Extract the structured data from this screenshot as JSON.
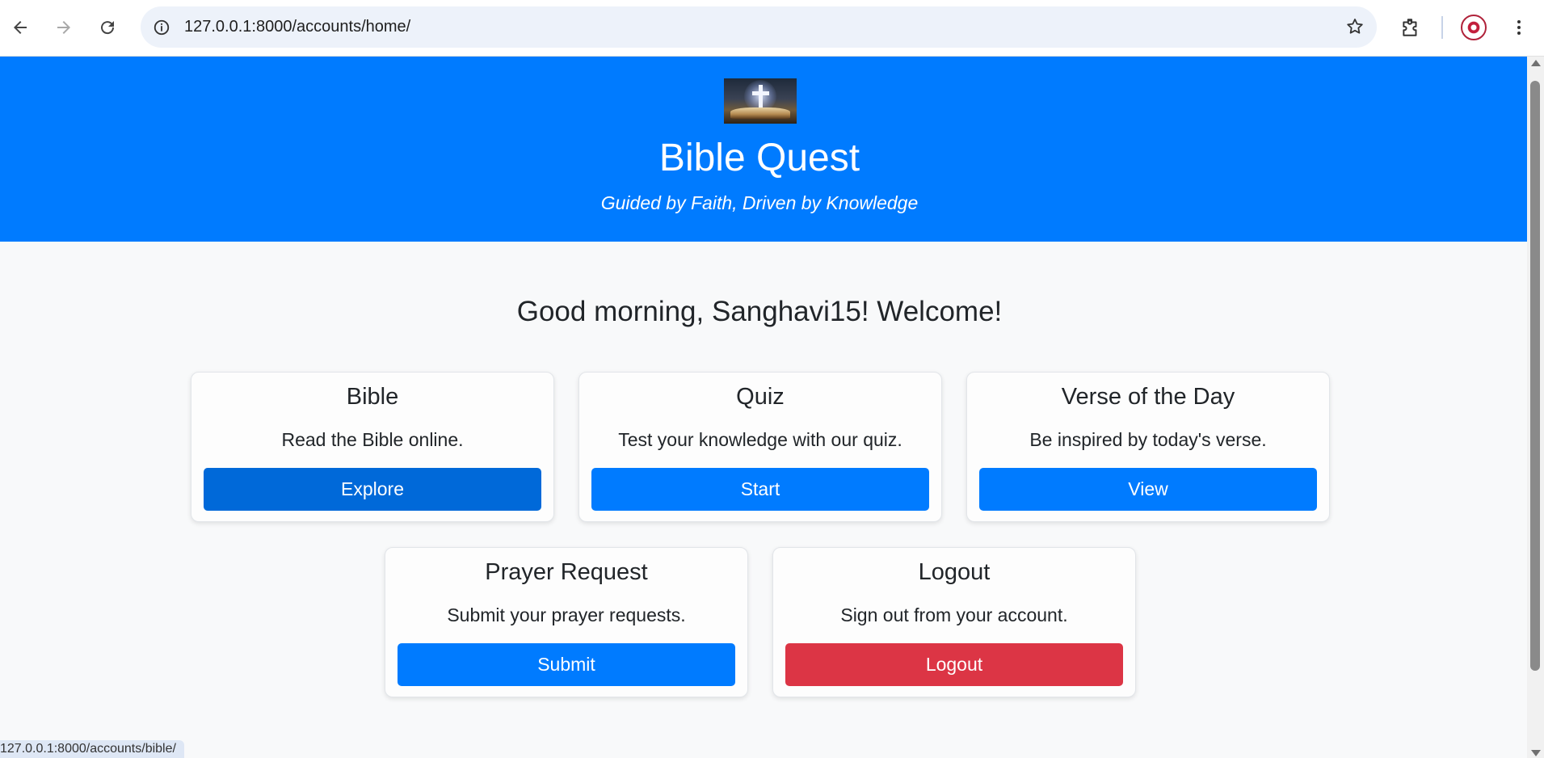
{
  "browser": {
    "url": "127.0.0.1:8000/accounts/home/",
    "status_url": "127.0.0.1:8000/accounts/bible/"
  },
  "header": {
    "logo_alt": "Bible with cross",
    "title": "Bible Quest",
    "tagline": "Guided by Faith, Driven by Knowledge"
  },
  "greeting": "Good morning, Sanghavi15! Welcome!",
  "cards": [
    {
      "title": "Bible",
      "description": "Read the Bible online.",
      "button": "Explore"
    },
    {
      "title": "Quiz",
      "description": "Test your knowledge with our quiz.",
      "button": "Start"
    },
    {
      "title": "Verse of the Day",
      "description": "Be inspired by today's verse.",
      "button": "View"
    },
    {
      "title": "Prayer Request",
      "description": "Submit your prayer requests.",
      "button": "Submit"
    },
    {
      "title": "Logout",
      "description": "Sign out from your account.",
      "button": "Logout"
    }
  ],
  "colors": {
    "primary": "#007bff",
    "primary_hover": "#0069d9",
    "danger": "#dc3545",
    "background": "#f8f9fa"
  }
}
